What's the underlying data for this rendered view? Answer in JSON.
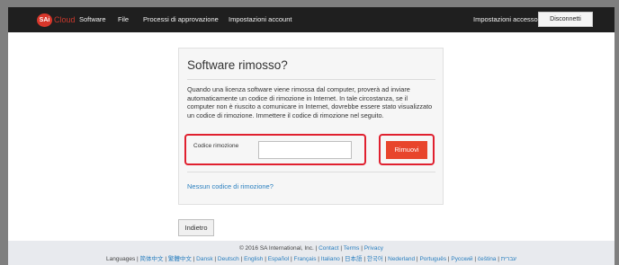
{
  "brand": {
    "badge": "SAi",
    "name": "Cloud",
    "brand_color": "#d8372b"
  },
  "nav": {
    "items": [
      "Software",
      "File",
      "Processi di approvazione",
      "Impostazioni account"
    ],
    "access_settings": "Impostazioni accesso",
    "logout_label": "Disconnetti"
  },
  "card": {
    "title": "Software rimosso?",
    "description": "Quando una licenza software viene rimossa dal computer, proverà ad inviare automaticamente un codice di rimozione in Internet. In tale circostanza, se il computer non è riuscito a comunicare in Internet, dovrebbe essere stato visualizzato un codice di rimozione. Immettere il codice di rimozione nel seguito.",
    "code_label": "Codice rimozione",
    "code_value": "",
    "remove_label": "Rimuovi",
    "no_code_link": "Nessun codice di rimozione?"
  },
  "back_label": "Indietro",
  "footer": {
    "copyright": "© 2016 SA International, Inc.",
    "contact": "Contact",
    "terms": "Terms",
    "privacy": "Privacy",
    "languages_label": "Languages",
    "languages": [
      "简体中文",
      "繁體中文",
      "Dansk",
      "Deutsch",
      "English",
      "Español",
      "Français",
      "Italiano",
      "日本語",
      "한국어",
      "Nederland",
      "Português",
      "Русский",
      "čeština",
      "עברית"
    ]
  },
  "colors": {
    "accent_button": "#e8452c",
    "link": "#2a7fbf",
    "highlight": "#e0202f",
    "navbar": "#1f1f1f"
  }
}
